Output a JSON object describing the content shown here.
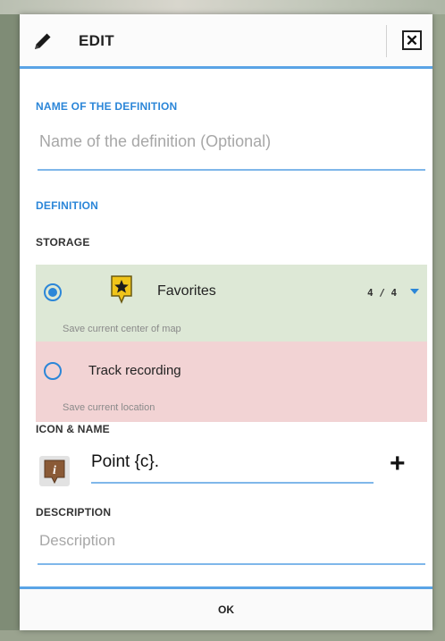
{
  "dialog": {
    "title": "EDIT",
    "close_symbol": "✕"
  },
  "name_section": {
    "label": "NAME OF THE DEFINITION",
    "placeholder": "Name of the definition (Optional)",
    "value": ""
  },
  "definition": {
    "label": "DEFINITION"
  },
  "storage": {
    "label": "STORAGE",
    "options": [
      {
        "label": "Favorites",
        "subtitle": "Save current center of map",
        "selected": true,
        "count": "4 / 4",
        "background": "#dde8d6",
        "icon": "favorites-star-icon"
      },
      {
        "label": "Track recording",
        "subtitle": "Save current location",
        "selected": false,
        "background": "#f2d3d4"
      }
    ]
  },
  "icon_name": {
    "label": "ICON & NAME",
    "value": "Point {c}.",
    "icon": "info-point-icon",
    "add_symbol": "+"
  },
  "description": {
    "label": "DESCRIPTION",
    "placeholder": "Description",
    "value": ""
  },
  "footer": {
    "ok_label": "OK"
  },
  "colors": {
    "accent": "#2b86d8",
    "header_line": "#5aa4e6",
    "favorites_bg": "#dde8d6",
    "track_bg": "#f2d3d4"
  }
}
